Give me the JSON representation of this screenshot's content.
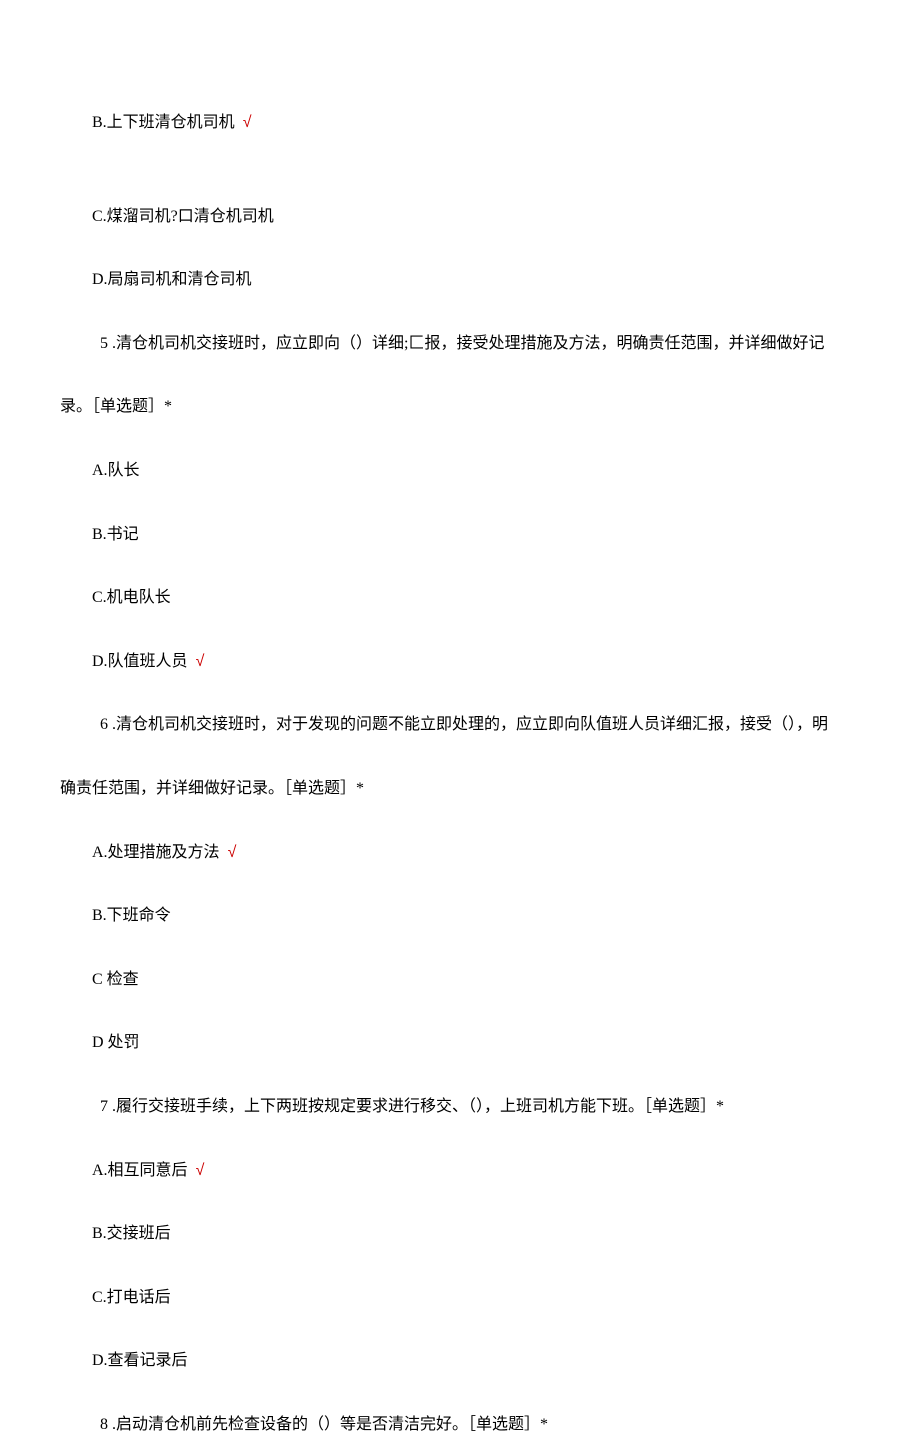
{
  "q4_options": {
    "B": "B.上下班清仓机司机",
    "B_mark": "√",
    "C": "C.煤溜司机?口清仓机司机",
    "D": "D.局扇司机和清仓司机"
  },
  "q5": {
    "number": "5",
    "text_part1": " .清仓机司机交接班时，应立即向（）详细;匚报，接受处理措施及方法，明确责任范围，并详细做好记",
    "text_part2": "录。［单选题］*",
    "options": {
      "A": "A.队长",
      "B": "B.书记",
      "C": "C.机电队长",
      "D": "D.队值班人员",
      "D_mark": "√"
    }
  },
  "q6": {
    "number": "6",
    "text_part1": "  .清仓机司机交接班时，对于发现的问题不能立即处理的，应立即向队值班人员详细汇报，接受（），明",
    "text_part2": "确责任范围，并详细做好记录。［单选题］*",
    "options": {
      "A": "A.处理措施及方法",
      "A_mark": "√",
      "B": "B.下班命令",
      "C": "C 检查",
      "D": "D 处罚"
    }
  },
  "q7": {
    "number": "7",
    "text": " .履行交接班手续，上下两班按规定要求进行移交、（），上班司机方能下班。［单选题］*",
    "options": {
      "A": "A.相互同意后",
      "A_mark": "√",
      "B": "B.交接班后",
      "C": "C.打电话后",
      "D": "D.查看记录后"
    }
  },
  "q8": {
    "number": "8",
    "text": " .启动清仓机前先检查设备的（）等是否清洁完好。［单选题］*"
  }
}
